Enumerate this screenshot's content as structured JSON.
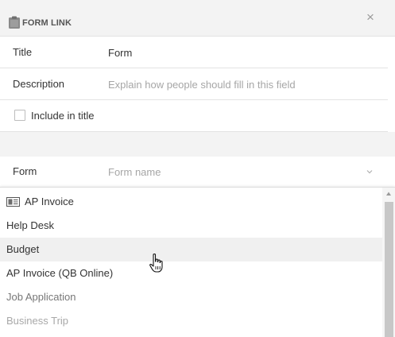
{
  "header": {
    "title": "FORM LINK",
    "icon": "clipboard-icon",
    "close_glyph": "×",
    "close_icon": "close-icon"
  },
  "fields": {
    "title": {
      "label": "Title",
      "value": "Form"
    },
    "description": {
      "label": "Description",
      "placeholder": "Explain how people should fill in this field"
    },
    "include_in_title": {
      "label": "Include in title",
      "checked": false
    },
    "form": {
      "label": "Form",
      "placeholder": "Form name",
      "icon": "chevron-down-icon"
    }
  },
  "dropdown": {
    "items": [
      {
        "label": "AP Invoice",
        "icon": "invoice-icon"
      },
      {
        "label": "Help Desk"
      },
      {
        "label": "Budget",
        "hovered": true
      },
      {
        "label": "AP Invoice (QB Online)"
      },
      {
        "label": "Job Application"
      },
      {
        "label": "Business Trip"
      }
    ]
  },
  "colors": {
    "header_bg": "#f3f3f3",
    "border": "#e3e3e3",
    "text": "#333333",
    "placeholder": "#a6a6a6",
    "hover_bg": "#f0f0f0",
    "scroll_thumb": "#c7c7c7"
  }
}
